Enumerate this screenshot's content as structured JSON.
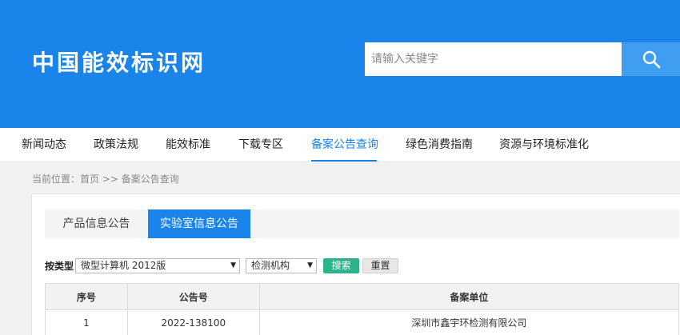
{
  "site": {
    "logo_text": "中国能效标识网"
  },
  "search": {
    "placeholder": "请输入关键字"
  },
  "nav": {
    "items": [
      {
        "label": "新闻动态"
      },
      {
        "label": "政策法规"
      },
      {
        "label": "能效标准"
      },
      {
        "label": "下载专区"
      },
      {
        "label": "备案公告查询"
      },
      {
        "label": "绿色消费指南"
      },
      {
        "label": "资源与环境标准化"
      }
    ],
    "active_index": 4
  },
  "breadcrumb": {
    "prefix": "当前位置：",
    "home": "首页",
    "separator": ">>",
    "current": "备案公告查询"
  },
  "tabs": [
    {
      "label": "产品信息公告",
      "active": false
    },
    {
      "label": "实验室信息公告",
      "active": true
    }
  ],
  "filter": {
    "label": "按类型",
    "type_value": "微型计算机 2012版",
    "org_value": "检测机构",
    "search_label": "搜索",
    "reset_label": "重置"
  },
  "table": {
    "headers": [
      "序号",
      "公告号",
      "备案单位"
    ],
    "rows": [
      {
        "index": "1",
        "notice_no": "2022-138100",
        "unit": "深圳市鑫宇环检测有限公司"
      }
    ]
  },
  "colors": {
    "brand": "#1a84ea",
    "search_button": "#3f9ef2",
    "search_action": "#2db38a"
  },
  "icons": {
    "search_button": "search-icon",
    "dropdown": "chevron-down-icon"
  }
}
